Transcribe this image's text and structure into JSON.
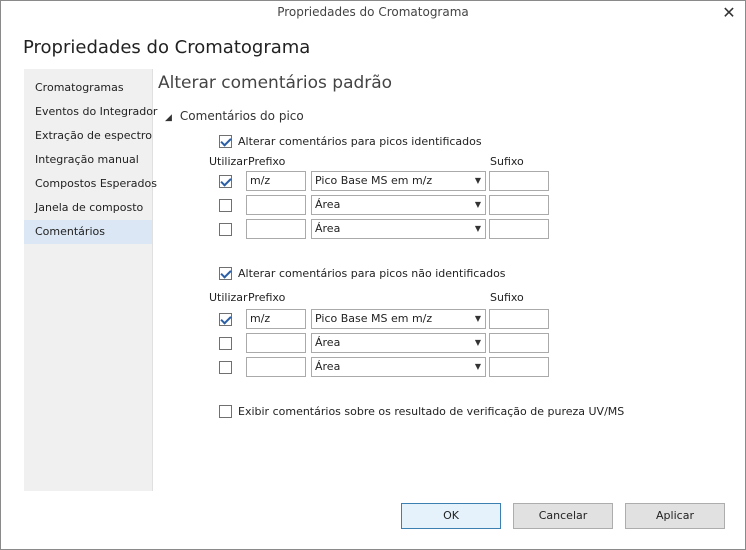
{
  "window": {
    "title": "Propriedades do Cromatograma",
    "close_icon": "close-icon"
  },
  "dialog": {
    "heading": "Propriedades do Cromatograma"
  },
  "sidebar": {
    "items": [
      {
        "label": "Cromatogramas"
      },
      {
        "label": "Eventos do Integrador"
      },
      {
        "label": "Extração de espectro"
      },
      {
        "label": "Integração manual"
      },
      {
        "label": "Compostos Esperados"
      },
      {
        "label": "Janela de composto"
      },
      {
        "label": "Comentários",
        "active": true
      }
    ]
  },
  "main": {
    "title": "Alterar comentários padrão",
    "group_title": "Comentários do pico",
    "identified": {
      "label": "Alterar comentários para picos identificados",
      "checked": true,
      "headers": {
        "use": "Utilizar",
        "prefix": "Prefixo",
        "suffix": "Sufixo"
      },
      "rows": [
        {
          "use": true,
          "prefix": "m/z",
          "field": "Pico Base MS em m/z",
          "suffix": ""
        },
        {
          "use": false,
          "prefix": "",
          "field": "Área",
          "suffix": ""
        },
        {
          "use": false,
          "prefix": "",
          "field": "Área",
          "suffix": ""
        }
      ]
    },
    "unidentified": {
      "label": "Alterar comentários para picos não identificados",
      "checked": true,
      "headers": {
        "use": "Utilizar",
        "prefix": "Prefixo",
        "suffix": "Sufixo"
      },
      "rows": [
        {
          "use": true,
          "prefix": "m/z",
          "field": "Pico Base MS em m/z",
          "suffix": ""
        },
        {
          "use": false,
          "prefix": "",
          "field": "Área",
          "suffix": ""
        },
        {
          "use": false,
          "prefix": "",
          "field": "Área",
          "suffix": ""
        }
      ]
    },
    "purity": {
      "label": "Exibir comentários sobre os resultado de verificação de pureza UV/MS",
      "checked": false
    }
  },
  "buttons": {
    "ok": "OK",
    "cancel": "Cancelar",
    "apply": "Aplicar"
  }
}
